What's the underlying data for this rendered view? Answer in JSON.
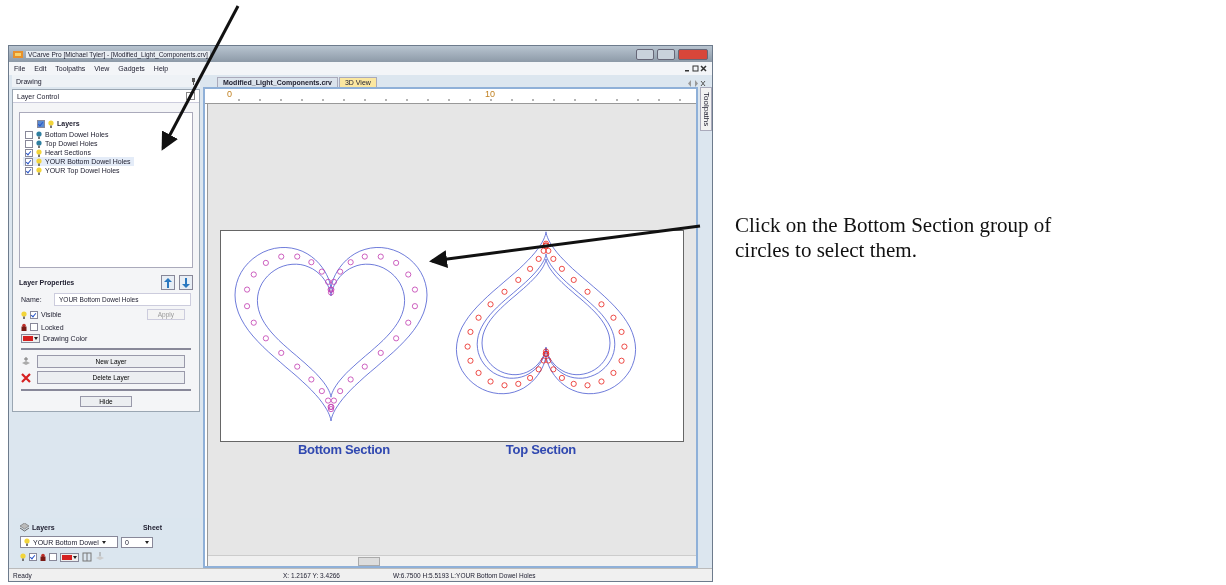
{
  "window": {
    "title": "VCarve Pro [Michael Tyler] - [Modified_Light_Components.crv]"
  },
  "menu": [
    "File",
    "Edit",
    "Toolpaths",
    "View",
    "Gadgets",
    "Help"
  ],
  "left_panel": {
    "header": "Drawing",
    "layer_control": {
      "title": "Layer Control",
      "root_label": "Layers",
      "layers": [
        {
          "name": "Bottom Dowel Holes",
          "checked": false,
          "selected": false
        },
        {
          "name": "Top Dowel Holes",
          "checked": false,
          "selected": false
        },
        {
          "name": "Heart Sections",
          "checked": true,
          "selected": false
        },
        {
          "name": "YOUR Bottom Dowel Holes",
          "checked": true,
          "selected": true
        },
        {
          "name": "YOUR Top Dowel Holes",
          "checked": true,
          "selected": false
        }
      ],
      "properties": {
        "title": "Layer Properties",
        "name_label": "Name:",
        "name_value": "YOUR Bottom Dowel Holes",
        "visible": {
          "label": "Visible",
          "checked": true
        },
        "locked": {
          "label": "Locked",
          "checked": false
        },
        "apply": "Apply",
        "color_label": "Drawing Color",
        "new_layer": "New Layer",
        "delete_layer": "Delete Layer",
        "hide": "Hide"
      }
    },
    "bottom": {
      "layers_label": "Layers",
      "sheet_label": "Sheet",
      "layer_value": "YOUR Bottom Dowel",
      "sheet_value": "0",
      "visible_checked": true,
      "locked_checked": false
    }
  },
  "document_tabs": [
    {
      "label": "Modified_Light_Components.crv",
      "selected": true
    },
    {
      "label": "3D View",
      "selected": false
    }
  ],
  "side_tab": "Toolpaths",
  "ruler_labels": [
    "0",
    "10"
  ],
  "canvas_labels": [
    "Bottom Section",
    "Top Section"
  ],
  "status_bar": {
    "left": "Ready",
    "coords": "X: 1.2167 Y: 3.4266",
    "info": "W:6.7500  H:5.5193  L:YOUR Bottom Dowel Holes"
  },
  "callout": {
    "lines": [
      "Click on the Bottom Section group of",
      "circles to select them."
    ]
  }
}
